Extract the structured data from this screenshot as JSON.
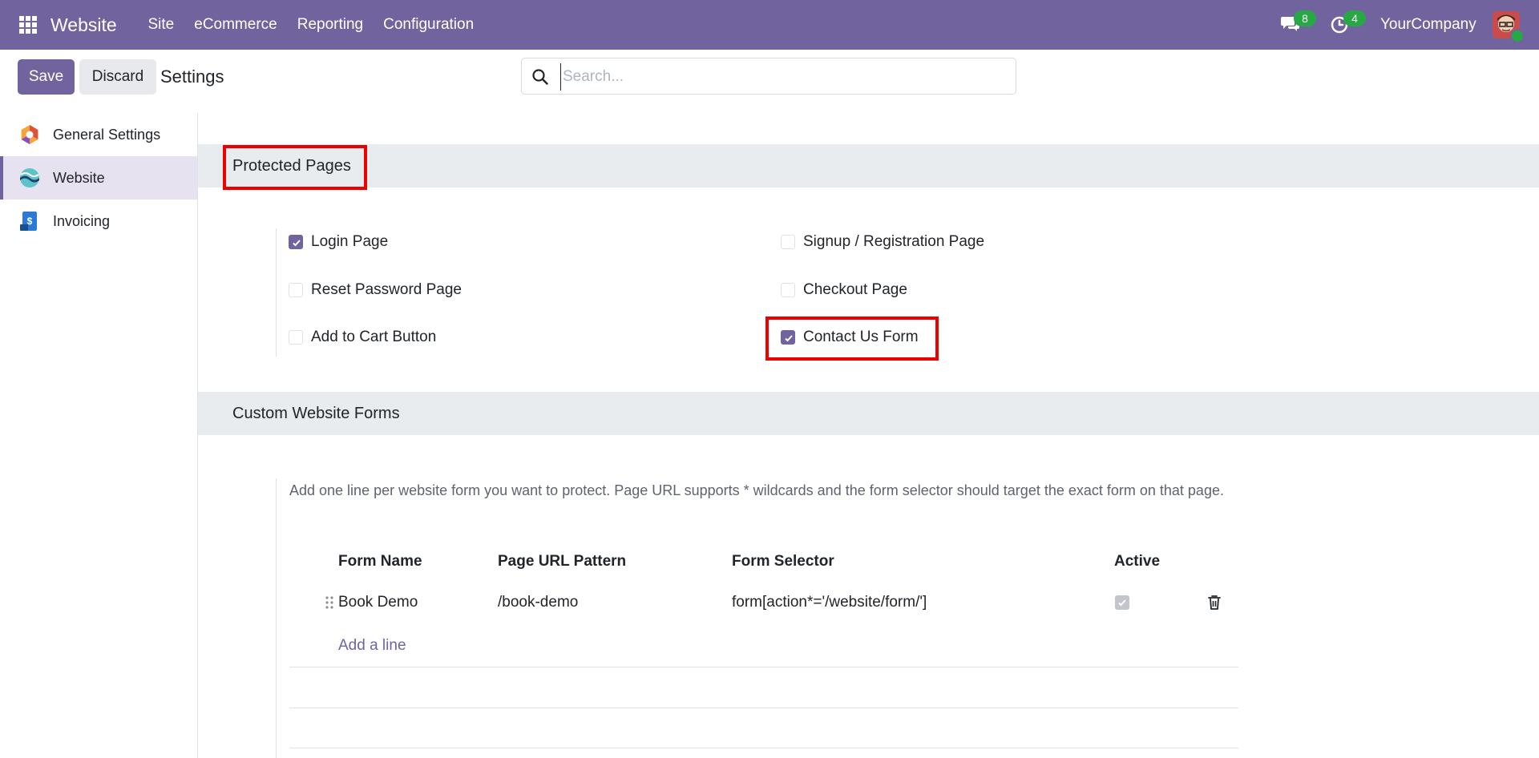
{
  "navbar": {
    "brand": "Website",
    "menu": [
      "Site",
      "eCommerce",
      "Reporting",
      "Configuration"
    ],
    "messages_count": "8",
    "activities_count": "4",
    "company": "YourCompany",
    "bg_color": "#71639e"
  },
  "control_panel": {
    "save_label": "Save",
    "discard_label": "Discard",
    "title": "Settings",
    "search_placeholder": "Search...",
    "search_value": ""
  },
  "sidebar": {
    "items": [
      {
        "label": "General Settings",
        "icon": "general-settings-icon",
        "active": false
      },
      {
        "label": "Website",
        "icon": "website-app-icon",
        "active": true
      },
      {
        "label": "Invoicing",
        "icon": "invoicing-app-icon",
        "active": false
      }
    ]
  },
  "protected_pages": {
    "title": "Protected Pages",
    "options": [
      {
        "label": "Login Page",
        "checked": true
      },
      {
        "label": "Signup / Registration Page",
        "checked": false
      },
      {
        "label": "Reset Password Page",
        "checked": false
      },
      {
        "label": "Checkout Page",
        "checked": false
      },
      {
        "label": "Add to Cart Button",
        "checked": false
      },
      {
        "label": "Contact Us Form",
        "checked": true
      }
    ]
  },
  "custom_forms": {
    "title": "Custom Website Forms",
    "help": "Add one line per website form you want to protect. Page URL supports * wildcards and the form selector should target the exact form on that page.",
    "columns": [
      "Form Name",
      "Page URL Pattern",
      "Form Selector",
      "Active"
    ],
    "rows": [
      {
        "form_name": "Book Demo",
        "page_url": "/book-demo",
        "form_selector": "form[action*='/website/form/']",
        "active": true
      }
    ],
    "add_line_label": "Add a line"
  },
  "colors": {
    "accent": "#71639e",
    "highlight": "#ee0000",
    "section_bg": "#e9ecef",
    "badge": "#28a745"
  }
}
